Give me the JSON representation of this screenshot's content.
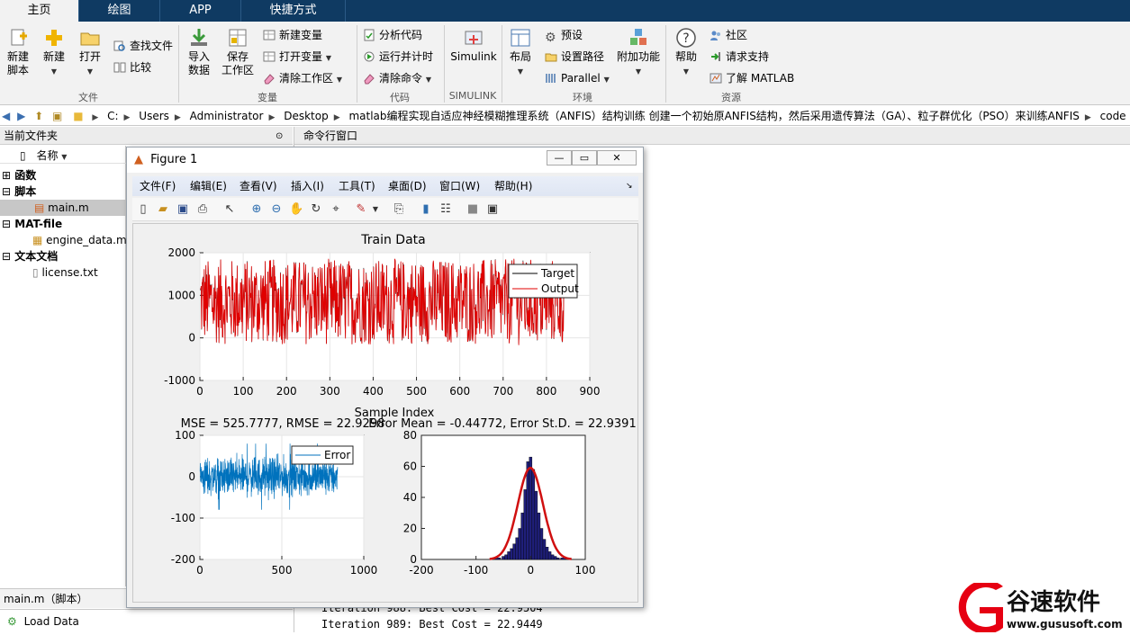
{
  "tabs": [
    {
      "label": "主页",
      "active": true
    },
    {
      "label": "绘图",
      "active": false
    },
    {
      "label": "APP",
      "active": false
    },
    {
      "label": "快捷方式",
      "active": false
    }
  ],
  "ribbon": {
    "new_script": "新建\n脚本",
    "new": "新建",
    "open": "打开",
    "find_files": "查找文件",
    "compare": "比较",
    "import_data": "导入\n数据",
    "save_workspace": "保存\n工作区",
    "new_variable": "新建变量",
    "open_variable": "打开变量",
    "clear_workspace": "清除工作区",
    "analyze_code": "分析代码",
    "run_and_time": "运行并计时",
    "clear_commands": "清除命令",
    "simulink": "Simulink",
    "layout": "布局",
    "preferences": "预设",
    "set_path": "设置路径",
    "parallel": "Parallel",
    "addons": "附加功能",
    "help": "帮助",
    "community": "社区",
    "request_support": "请求支持",
    "learn_matlab": "了解 MATLAB",
    "groups": {
      "file": "文件",
      "variable": "变量",
      "code": "代码",
      "simulink": "SIMULINK",
      "environment": "环境",
      "resources": "资源"
    }
  },
  "address": {
    "crumbs": [
      "C:",
      "Users",
      "Administrator",
      "Desktop",
      "matlab编程实现自适应神经模糊推理系统（ANFIS）结构训练 创建一个初始原ANFIS结构，然后采用遗传算法（GA）、粒子群优化（PSO）来训练ANFIS",
      "code"
    ]
  },
  "left_panel": {
    "title": "当前文件夹",
    "column_name": "名称",
    "groups": [
      {
        "label": "函数",
        "items": []
      },
      {
        "label": "脚本",
        "items": [
          "main.m"
        ]
      },
      {
        "label": "MAT-file",
        "items": [
          "engine_data.m"
        ]
      },
      {
        "label": "文本文档",
        "items": [
          "license.txt"
        ]
      }
    ],
    "status_file": "main.m（脚本）",
    "details_item": "Load Data"
  },
  "command_window": {
    "title": "命令行窗口",
    "lines": [
      "Iteration 988: Best Cost = 22.9504",
      "Iteration 989: Best Cost = 22.9449"
    ]
  },
  "figure": {
    "title": "Figure 1",
    "menu": [
      "文件(F)",
      "编辑(E)",
      "查看(V)",
      "插入(I)",
      "工具(T)",
      "桌面(D)",
      "窗口(W)",
      "帮助(H)"
    ]
  },
  "chart_data": [
    {
      "type": "line",
      "title": "Train Data",
      "xlabel": "Sample Index",
      "ylabel": "",
      "xlim": [
        0,
        900
      ],
      "ylim": [
        -1000,
        2000
      ],
      "xticks": [
        "0",
        "100",
        "200",
        "300",
        "400",
        "500",
        "600",
        "700",
        "800",
        "900"
      ],
      "yticks": [
        "2000",
        "1000",
        "0",
        "-1000"
      ],
      "grid": true,
      "legend_position": "top-right",
      "series": [
        {
          "name": "Target",
          "color": "#000000",
          "n_points": 840,
          "y_range": [
            -150,
            1850
          ]
        },
        {
          "name": "Output",
          "color": "#e00000",
          "n_points": 840,
          "y_range": [
            -150,
            1850
          ]
        }
      ]
    },
    {
      "type": "line",
      "title": "MSE = 525.7777, RMSE = 22.9298",
      "xlim": [
        0,
        1000
      ],
      "ylim": [
        -200,
        100
      ],
      "xticks": [
        "0",
        "500",
        "1000"
      ],
      "yticks": [
        "100",
        "0",
        "-100",
        "-200"
      ],
      "grid": true,
      "legend_position": "top-right",
      "series": [
        {
          "name": "Error",
          "color": "#0072bd",
          "n_points": 840,
          "y_range": [
            -100,
            100
          ]
        }
      ]
    },
    {
      "type": "bar",
      "title": "Error Mean = -0.44772, Error St.D. = 22.9391",
      "xlim": [
        -200,
        100
      ],
      "ylim": [
        0,
        80
      ],
      "xticks": [
        "-200",
        "-100",
        "0",
        "100"
      ],
      "yticks": [
        "80",
        "60",
        "40",
        "20",
        "0"
      ],
      "grid": false,
      "bins_center": [
        -70,
        -60,
        -50,
        -45,
        -40,
        -35,
        -30,
        -25,
        -20,
        -15,
        -10,
        -5,
        0,
        5,
        10,
        15,
        20,
        25,
        30,
        35,
        40,
        45,
        50,
        60,
        70
      ],
      "values": [
        1,
        1,
        2,
        3,
        5,
        7,
        10,
        14,
        20,
        30,
        45,
        63,
        66,
        58,
        44,
        30,
        20,
        13,
        8,
        5,
        3,
        2,
        1,
        1,
        1
      ],
      "bar_color": "#1f1f7a",
      "fit": {
        "type": "normal",
        "mean": -0.44772,
        "std": 22.9391,
        "peak": 59,
        "color": "#d01010"
      }
    }
  ],
  "watermark": {
    "brand": "谷速软件",
    "url": "www.gususoft.com"
  }
}
